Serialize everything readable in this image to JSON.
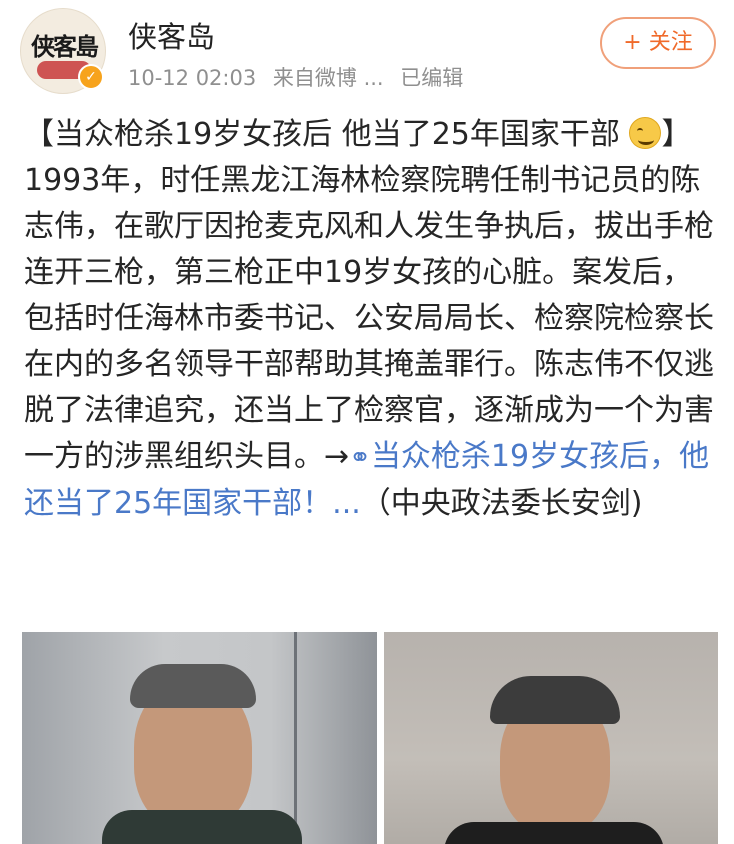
{
  "header": {
    "avatar_logo": "侠客島",
    "username": "侠客岛",
    "timestamp": "10-12 02:03",
    "source": "来自微博 ...",
    "edited": "已编辑",
    "follow_label": "+ 关注",
    "verified_icon": "verified-badge-icon"
  },
  "post": {
    "title_prefix": "【当众枪杀19岁女孩后 他当了25年国家干部",
    "emoji_icon": "sweat-smile-emoji-icon",
    "body": "】1993年，时任黑龙江海林检察院聘任制书记员的陈志伟，在歌厅因抢麦克风和人发生争执后，拔出手枪连开三枪，第三枪正中19岁女孩的心脏。案发后，包括时任海林市委书记、公安局局长、检察院检察长在内的多名领导干部帮助其掩盖罪行。陈志伟不仅逃脱了法律追究，还当上了检察官，逐渐成为一个为害一方的涉黑组织头目。→",
    "link_icon": "link-icon",
    "link_text": "当众枪杀19岁女孩后，他还当了25年国家干部！...",
    "source_note": "（中央政法委长安剑)"
  },
  "colors": {
    "link": "#4a79c8",
    "follow_accent": "#f06a2a",
    "meta_gray": "#8f8f8f"
  }
}
